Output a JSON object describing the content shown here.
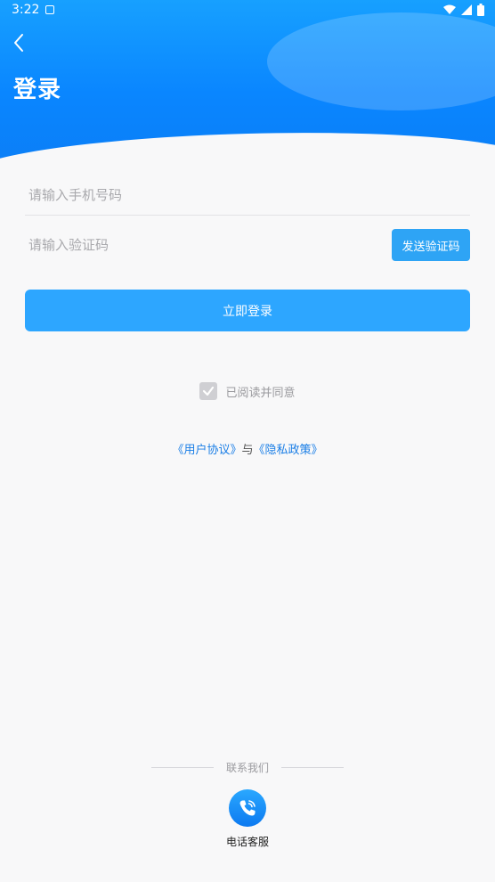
{
  "status_bar": {
    "time": "3:22"
  },
  "header": {
    "title": "登录"
  },
  "form": {
    "phone_placeholder": "请输入手机号码",
    "code_placeholder": "请输入验证码",
    "send_code_label": "发送验证码",
    "login_label": "立即登录"
  },
  "agreement": {
    "text": "已阅读并同意",
    "user_agreement": "《用户协议》",
    "and": "与",
    "privacy_policy": "《隐私政策》"
  },
  "contact": {
    "title": "联系我们",
    "phone_service_label": "电话客服"
  },
  "colors": {
    "brand": "#0a86ff",
    "button": "#2da6ff",
    "link": "#1a7ee6"
  }
}
